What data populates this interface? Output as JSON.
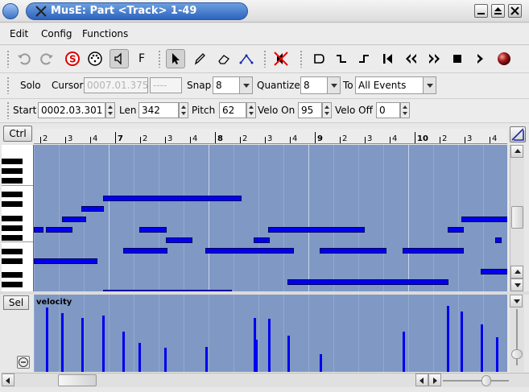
{
  "window": {
    "title": "MusE: Part <Track> 1-49"
  },
  "menubar": {
    "items": [
      {
        "label": "Edit"
      },
      {
        "label": "Config"
      },
      {
        "label": "Functions"
      }
    ]
  },
  "toolbar1": {
    "buttons": [
      "undo-icon",
      "redo-icon",
      "solo-s-icon",
      "midi-icon",
      "speaker-icon",
      "F",
      "pointer-icon",
      "pencil-icon",
      "eraser-icon",
      "line-draw-icon",
      "mute-speaker-icon",
      "loop-icon",
      "punchin-icon",
      "punchout-icon",
      "rewind-start-icon",
      "rewind-icon",
      "forward-icon",
      "stop-icon",
      "play-icon",
      "record-icon"
    ],
    "f_label": "F"
  },
  "toolbar2": {
    "solo_label": "Solo",
    "cursor_label": "Cursor",
    "cursor_value": "0007.01.375",
    "cursor_tick": "----",
    "snap_label": "Snap",
    "snap_value": "8",
    "quantize_label": "Quantize",
    "quantize_value": "8",
    "to_label": "To",
    "to_value": "All Events"
  },
  "toolbar3": {
    "start_label": "Start",
    "start_value": "0002.03.301",
    "len_label": "Len",
    "len_value": "342",
    "pitch_label": "Pitch",
    "pitch_value": "62",
    "velo_on_label": "Velo On",
    "velo_on_value": "95",
    "velo_off_label": "Velo Off",
    "velo_off_value": "0"
  },
  "editor": {
    "ctrl_button": "Ctrl",
    "sel_button": "Sel",
    "controller_label": "velocity",
    "ruler": [
      "2",
      "3",
      "4",
      "7",
      "2",
      "3",
      "4",
      "8",
      "2",
      "3",
      "4",
      "9",
      "2",
      "3",
      "4",
      "10",
      "2",
      "3",
      "4"
    ],
    "bar_numbers": [
      "7",
      "8",
      "9",
      "10"
    ]
  },
  "colors": {
    "note": "#0000ee",
    "roll_bg": "#7f98c4",
    "title_pill": "#2d63bd"
  }
}
